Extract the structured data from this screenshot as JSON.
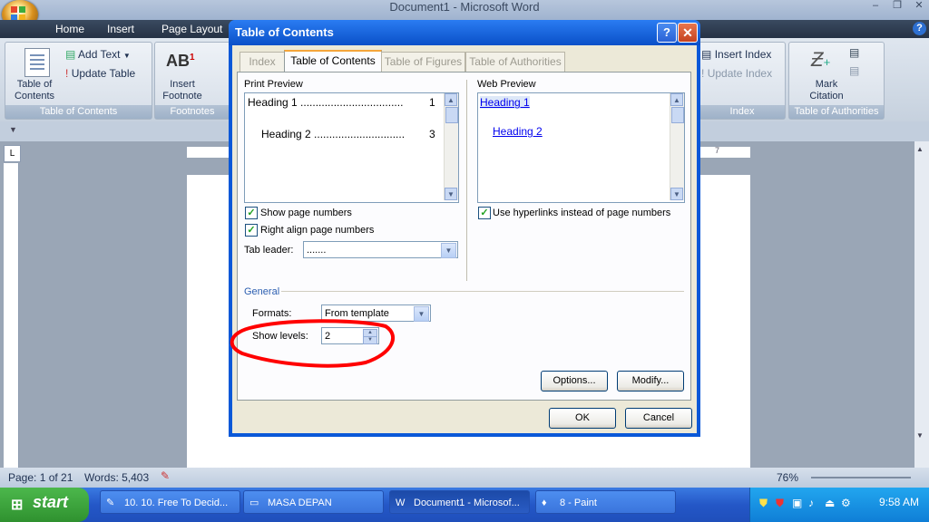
{
  "window": {
    "title": "Document1 - Microsoft Word"
  },
  "ribbon_tabs": [
    "Home",
    "Insert",
    "Page Layout"
  ],
  "ribbon": {
    "toc_group": {
      "label": "Table of Contents",
      "toc_button": "Table of Contents",
      "add_text": "Add Text",
      "update_table": "Update Table"
    },
    "footnotes_group": {
      "label": "Footnotes",
      "insert_footnote": "Insert Footnote"
    },
    "index_group": {
      "label": "Index",
      "insert_index": "Insert Index",
      "update_index": "Update Index"
    },
    "authorities_group": {
      "label": "Table of Authorities",
      "mark_citation": "Mark Citation"
    }
  },
  "dialog": {
    "title": "Table of Contents",
    "tabs": [
      "Index",
      "Table of Contents",
      "Table of Figures",
      "Table of Authorities"
    ],
    "print_preview": {
      "label": "Print Preview",
      "entries": [
        {
          "text": "Heading 1 ..................................",
          "page": "1"
        },
        {
          "text": "Heading 2 ..............................",
          "page": "3"
        }
      ]
    },
    "web_preview": {
      "label": "Web Preview",
      "links": [
        "Heading 1",
        "Heading 2"
      ]
    },
    "show_page_numbers": "Show page numbers",
    "right_align": "Right align page numbers",
    "use_hyperlinks": "Use hyperlinks instead of page numbers",
    "tab_leader_label": "Tab leader:",
    "tab_leader_value": ".......",
    "general_label": "General",
    "formats_label": "Formats:",
    "formats_value": "From template",
    "show_levels_label": "Show levels:",
    "show_levels_value": "2",
    "options_button": "Options...",
    "modify_button": "Modify...",
    "ok_button": "OK",
    "cancel_button": "Cancel"
  },
  "ruler": {
    "marker": "7"
  },
  "status": {
    "page": "Page: 1 of 21",
    "words": "Words: 5,403",
    "zoom": "76%"
  },
  "taskbar": {
    "start": "start",
    "tasks": [
      "10. 10. Free To Decid...",
      "MASA DEPAN",
      "Document1 - Microsof...",
      "8 - Paint"
    ],
    "clock": "9:58 AM"
  },
  "colors": {
    "highlight": "#ff0000",
    "xp_blue": "#0a58d8",
    "link": "#0000ee"
  }
}
